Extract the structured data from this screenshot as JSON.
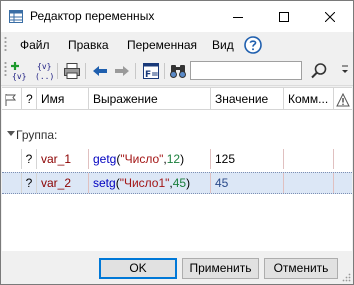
{
  "window": {
    "title": "Редактор переменных"
  },
  "menu": {
    "items": [
      "Файл",
      "Правка",
      "Переменная",
      "Вид"
    ]
  },
  "toolbar": {
    "icons": [
      "add-variable-icon",
      "insert-variable-icon",
      "print-icon",
      "undo-icon",
      "redo-icon",
      "format-icon",
      "find-icon",
      "search-icon"
    ],
    "search": {
      "value": "",
      "placeholder": ""
    }
  },
  "grid": {
    "columns": {
      "q": "?",
      "name": "Имя",
      "expression": "Выражение",
      "value": "Значение",
      "comment": "Комм..."
    },
    "group": {
      "label": "Группа:"
    },
    "rows": [
      {
        "q": "?",
        "name": "var_1",
        "expr": {
          "fn": "getg",
          "open": "(",
          "str": "\"Число\"",
          "comma": ",",
          "num": "12",
          "close": ")"
        },
        "value": "125",
        "comment": "",
        "selected": false
      },
      {
        "q": "?",
        "name": "var_2",
        "expr": {
          "fn": "setg",
          "open": "(",
          "str": "\"Число1\"",
          "comma": ",",
          "num": "45",
          "close": ")"
        },
        "value": "45",
        "comment": "",
        "selected": true
      }
    ]
  },
  "buttons": {
    "ok": "OK",
    "apply": "Применить",
    "cancel": "Отменить"
  },
  "colors": {
    "name": "#8b0000",
    "function": "#0000c0",
    "string": "#a31515",
    "number": "#1a7f3c",
    "selection": "#dce7f6",
    "default_button_border": "#0078d7"
  }
}
